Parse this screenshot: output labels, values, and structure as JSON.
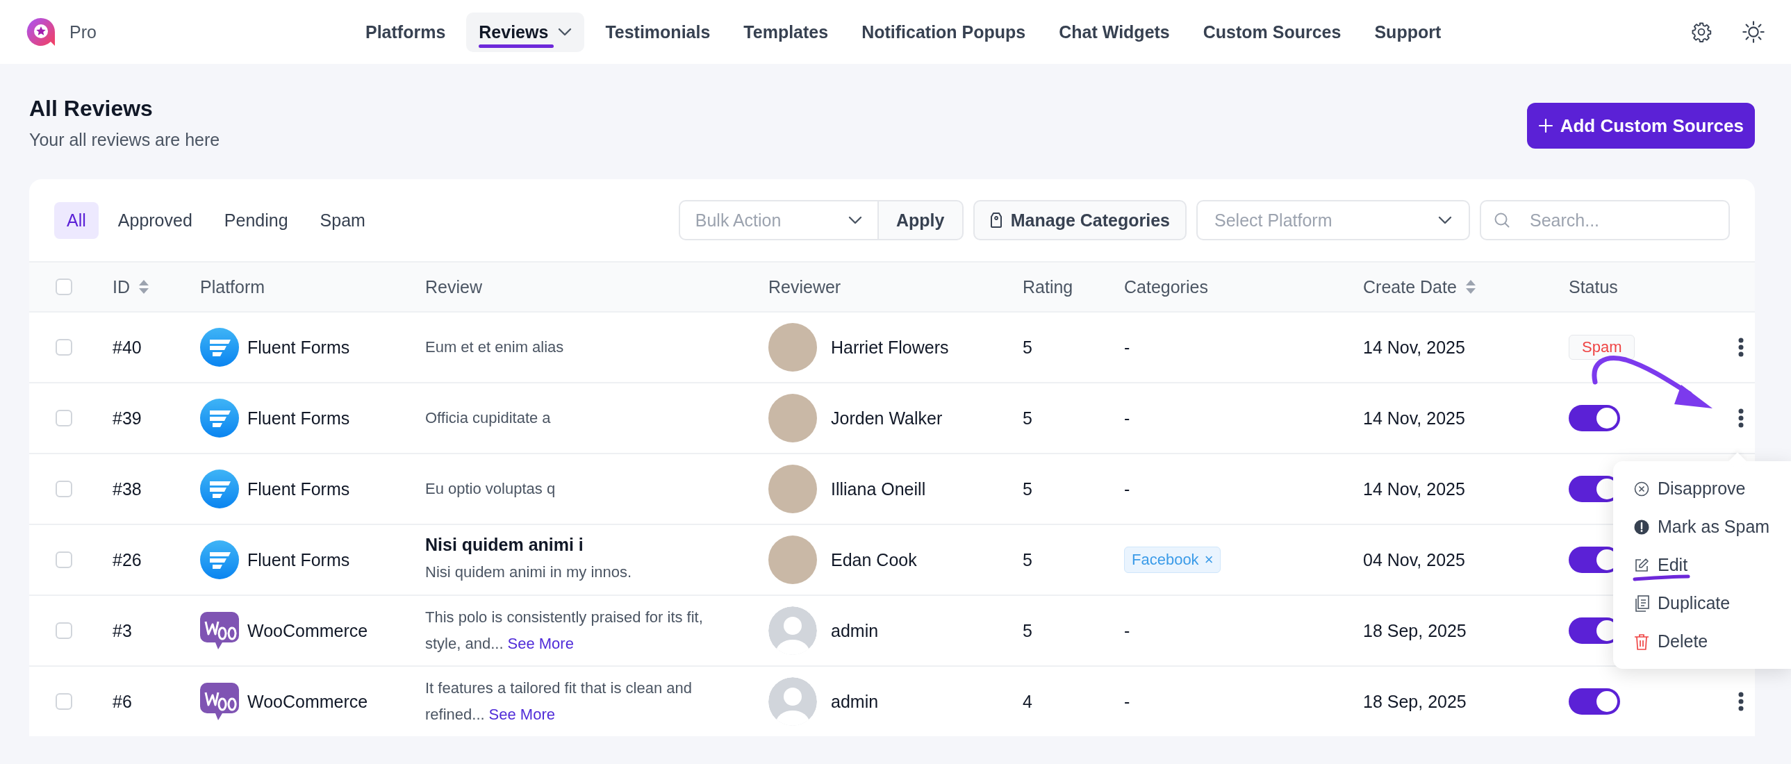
{
  "app": {
    "name": "Pro"
  },
  "nav": {
    "items": [
      {
        "label": "Platforms",
        "selected": false,
        "has_dropdown": false
      },
      {
        "label": "Reviews",
        "selected": true,
        "has_dropdown": true
      },
      {
        "label": "Testimonials",
        "selected": false,
        "has_dropdown": false
      },
      {
        "label": "Templates",
        "selected": false,
        "has_dropdown": false
      },
      {
        "label": "Notification Popups",
        "selected": false,
        "has_dropdown": false
      },
      {
        "label": "Chat Widgets",
        "selected": false,
        "has_dropdown": false
      },
      {
        "label": "Custom Sources",
        "selected": false,
        "has_dropdown": false
      },
      {
        "label": "Support",
        "selected": false,
        "has_dropdown": false
      }
    ]
  },
  "page": {
    "title": "All Reviews",
    "subtitle": "Your all reviews are here",
    "add_button": "Add Custom Sources"
  },
  "filter_tabs": [
    {
      "label": "All",
      "selected": true
    },
    {
      "label": "Approved",
      "selected": false
    },
    {
      "label": "Pending",
      "selected": false
    },
    {
      "label": "Spam",
      "selected": false
    }
  ],
  "toolbar": {
    "bulk_action": {
      "placeholder": "Bulk Action"
    },
    "apply": "Apply",
    "manage_categories": "Manage Categories",
    "platform_select": {
      "placeholder": "Select Platform"
    },
    "search": {
      "placeholder": "Search..."
    }
  },
  "table": {
    "select_all_checked": false,
    "columns": [
      {
        "label": "ID",
        "sortable": true
      },
      {
        "label": "Platform",
        "sortable": false
      },
      {
        "label": "Review",
        "sortable": false
      },
      {
        "label": "Reviewer",
        "sortable": false
      },
      {
        "label": "Rating",
        "sortable": false
      },
      {
        "label": "Categories",
        "sortable": false
      },
      {
        "label": "Create Date",
        "sortable": true
      },
      {
        "label": "Status",
        "sortable": false
      }
    ],
    "rows": [
      {
        "checked": false,
        "id": "#40",
        "platform": {
          "name": "Fluent Forms",
          "kind": "fluent"
        },
        "review": {
          "text": "Eum et et enim alias"
        },
        "reviewer": {
          "name": "Harriet Flowers",
          "avatar": {
            "kind": "photo"
          }
        },
        "rating": "5",
        "category": {
          "kind": "text",
          "text": "-"
        },
        "date": "14 Nov, 2025",
        "status": {
          "kind": "badge",
          "label": "Spam"
        },
        "menu_open": false
      },
      {
        "checked": false,
        "id": "#39",
        "platform": {
          "name": "Fluent Forms",
          "kind": "fluent"
        },
        "review": {
          "text": "Officia cupiditate a"
        },
        "reviewer": {
          "name": "Jorden Walker",
          "avatar": {
            "kind": "photo"
          }
        },
        "rating": "5",
        "category": {
          "kind": "text",
          "text": "-"
        },
        "date": "14 Nov, 2025",
        "status": {
          "kind": "toggle",
          "on": true
        },
        "menu_open": true
      },
      {
        "checked": false,
        "id": "#38",
        "platform": {
          "name": "Fluent Forms",
          "kind": "fluent"
        },
        "review": {
          "text": "Eu optio voluptas q"
        },
        "reviewer": {
          "name": "Illiana Oneill",
          "avatar": {
            "kind": "photo"
          }
        },
        "rating": "5",
        "category": {
          "kind": "text",
          "text": "-"
        },
        "date": "14 Nov, 2025",
        "status": {
          "kind": "toggle",
          "on": true
        },
        "menu_open": false
      },
      {
        "checked": false,
        "id": "#26",
        "platform": {
          "name": "Fluent Forms",
          "kind": "fluent"
        },
        "review": {
          "title": "Nisi quidem animi i",
          "text": "Nisi quidem animi in my innos."
        },
        "reviewer": {
          "name": "Edan Cook",
          "avatar": {
            "kind": "photo"
          }
        },
        "rating": "5",
        "category": {
          "kind": "tag",
          "text": "Facebook",
          "remove": "×"
        },
        "date": "04 Nov, 2025",
        "status": {
          "kind": "toggle",
          "on": true
        },
        "menu_open": false
      },
      {
        "checked": false,
        "id": "#3",
        "platform": {
          "name": "WooCommerce",
          "kind": "woo"
        },
        "review": {
          "text": "This polo is consistently praised for its fit, style, and...",
          "see_more": "See More"
        },
        "reviewer": {
          "name": "admin",
          "avatar": {
            "kind": "default"
          }
        },
        "rating": "5",
        "category": {
          "kind": "text",
          "text": "-"
        },
        "date": "18 Sep, 2025",
        "status": {
          "kind": "toggle",
          "on": true
        },
        "menu_open": false
      },
      {
        "checked": false,
        "id": "#6",
        "platform": {
          "name": "WooCommerce",
          "kind": "woo"
        },
        "review": {
          "text": "It features a tailored fit that is clean and refined...",
          "see_more": "See More"
        },
        "reviewer": {
          "name": "admin",
          "avatar": {
            "kind": "default"
          }
        },
        "rating": "4",
        "category": {
          "kind": "text",
          "text": "-"
        },
        "date": "18 Sep, 2025",
        "status": {
          "kind": "toggle",
          "on": true
        },
        "menu_open": false
      }
    ]
  },
  "row_menu": {
    "items": [
      {
        "label": "Disapprove",
        "kind": "disapprove",
        "annotated": false
      },
      {
        "label": "Mark as Spam",
        "kind": "spam",
        "annotated": false
      },
      {
        "label": "Edit",
        "kind": "edit",
        "annotated": true
      },
      {
        "label": "Duplicate",
        "kind": "duplicate",
        "annotated": false
      },
      {
        "label": "Delete",
        "kind": "delete",
        "annotated": false
      }
    ]
  }
}
